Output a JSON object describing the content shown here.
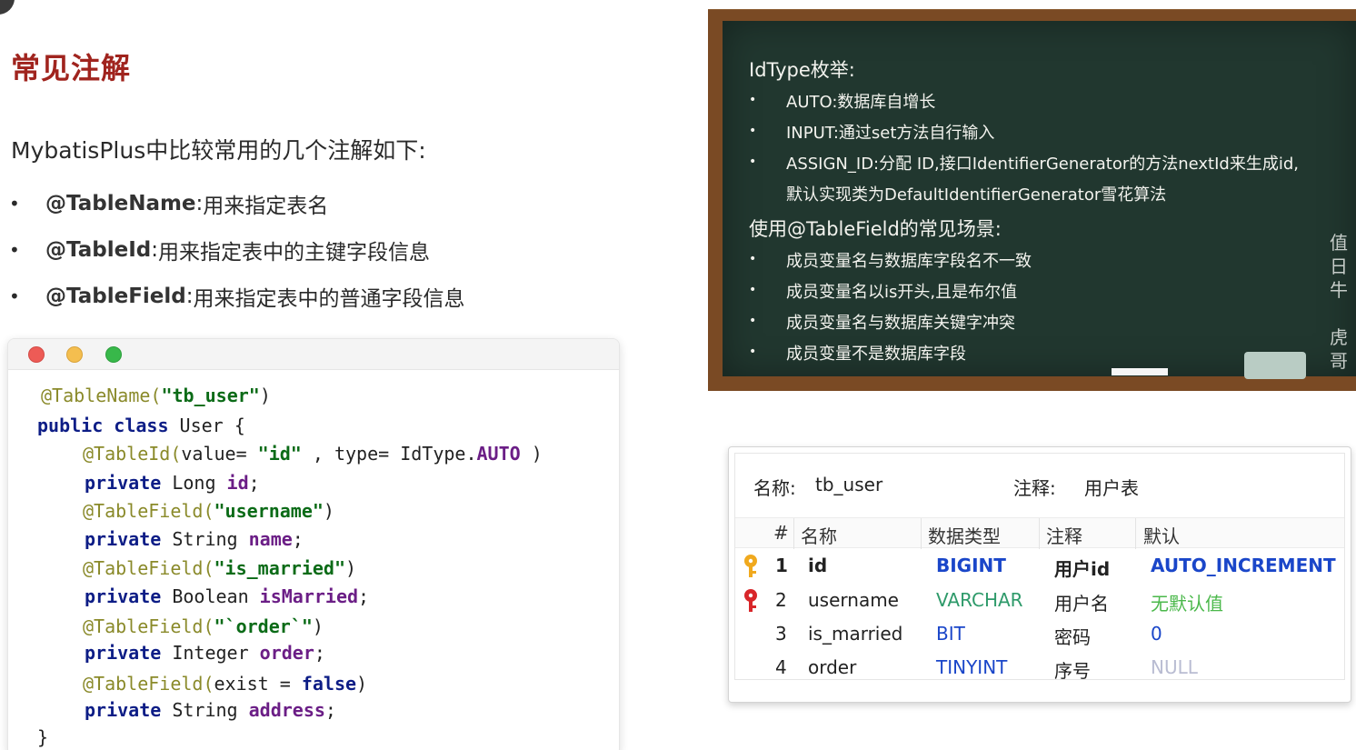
{
  "slide": {
    "title": "常见注解",
    "intro": "MybatisPlus中比较常用的几个注解如下:",
    "bullets": [
      {
        "annotation": "@TableName",
        "separator": ": ",
        "desc": "用来指定表名"
      },
      {
        "annotation": "@TableId",
        "separator": ": ",
        "desc": "用来指定表中的主键字段信息"
      },
      {
        "annotation": "@TableField",
        "separator": ": ",
        "desc": "用来指定表中的普通字段信息"
      }
    ]
  },
  "code": {
    "l1_ann": "@TableName(",
    "l1_str": "\"tb_user\"",
    "l1_end": ")",
    "l2_kw": "public class",
    "l2_rest": " User {",
    "l3_ann": "@TableId(",
    "l3_a": "value= ",
    "l3_str": "\"id\"",
    "l3_b": " , type= IdType.",
    "l3_enum": "AUTO",
    "l3_end": " )",
    "l4_kw": "private",
    "l4_type": " Long ",
    "l4_field": "id",
    "l4_end": ";",
    "l5_ann": "@TableField(",
    "l5_str": "\"username\"",
    "l5_end": ")",
    "l6_kw": "private",
    "l6_type": " String ",
    "l6_field": "name",
    "l6_end": ";",
    "l7_ann": "@TableField(",
    "l7_str": "\"is_married\"",
    "l7_end": ")",
    "l8_kw": "private",
    "l8_type": " Boolean ",
    "l8_field": "isMarried",
    "l8_end": ";",
    "l9_ann": "@TableField(",
    "l9_str": "\"`order`\"",
    "l9_end": ")",
    "l10_kw": "private",
    "l10_type": " Integer ",
    "l10_field": "order",
    "l10_end": ";",
    "l11_ann": "@TableField(",
    "l11_a": "exist = ",
    "l11_kw": "false",
    "l11_end": ")",
    "l12_kw": "private",
    "l12_type": " String ",
    "l12_field": "address",
    "l12_end": ";",
    "l13": "}"
  },
  "board": {
    "heading1": "IdType枚举:",
    "items1": [
      "AUTO:数据库自增长",
      "INPUT:通过set方法自行输入",
      "ASSIGN_ID:分配 ID,接口IdentifierGenerator的方法nextId来生成id,",
      "默认实现类为DefaultIdentifierGenerator雪花算法"
    ],
    "heading2": "使用@TableField的常见场景:",
    "items2": [
      "成员变量名与数据库字段名不一致",
      "成员变量名以is开头,且是布尔值",
      "成员变量名与数据库关键字冲突",
      "成员变量不是数据库字段"
    ],
    "watermark": [
      "值",
      "日",
      "牛",
      "",
      "虎",
      "哥"
    ]
  },
  "db_table": {
    "name_label": "名称:",
    "name_value": "tb_user",
    "comment_label": "注释:",
    "comment_value": "用户表",
    "columns": [
      "#",
      "名称",
      "数据类型",
      "注释",
      "默认"
    ],
    "rows": [
      {
        "num": "1",
        "name": "id",
        "type": "BIGINT",
        "comment": "用户id",
        "default": "AUTO_INCREMENT",
        "default_color": "#1a46c9",
        "key": "primary"
      },
      {
        "num": "2",
        "name": "username",
        "type": "VARCHAR",
        "comment": "用户名",
        "default": "无默认值",
        "default_color": "#4bb84b",
        "key": "unique"
      },
      {
        "num": "3",
        "name": "is_married",
        "type": "BIT",
        "comment": "密码",
        "default": "0",
        "default_color": "#1a46c9",
        "key": ""
      },
      {
        "num": "4",
        "name": "order",
        "type": "TINYINT",
        "comment": "序号",
        "default": "NULL",
        "default_color": "#b9bcd2",
        "key": ""
      }
    ]
  },
  "colors": {
    "title": "#a0241e",
    "chalkboard": "#21372f",
    "frame": "#7a4a24",
    "primary_key_icon": "#f0a91e",
    "unique_key_icon": "#d8262a"
  }
}
